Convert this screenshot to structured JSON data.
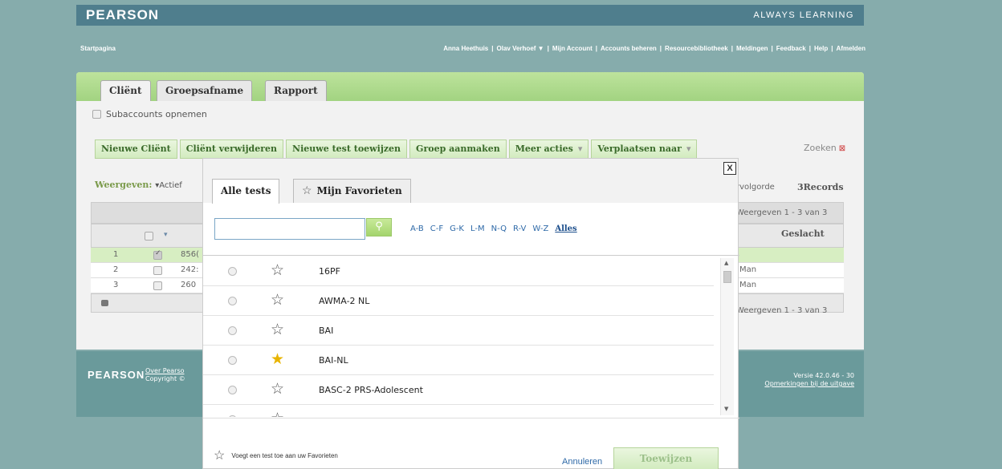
{
  "header": {
    "logo": "PEARSON",
    "slogan": "ALWAYS LEARNING"
  },
  "nav": {
    "home": "Startpagina",
    "user": "Anna Heethuis",
    "links": [
      "Olav Verhoef ▼",
      "Mijn Account",
      "Accounts beheren",
      "Resourcebibliotheek",
      "Meldingen",
      "Feedback",
      "Help",
      "Afmelden"
    ]
  },
  "tabs": [
    "Cliënt",
    "Groepsafname",
    "Rapport"
  ],
  "subaccounts_label": "Subaccounts opnemen",
  "toolbar": {
    "buttons": [
      "Nieuwe Cliënt",
      "Cliënt verwijderen",
      "Nieuwe test toewijzen",
      "Groep aanmaken",
      "Meer acties",
      "Verplaatsen naar"
    ],
    "search": "Zoeken"
  },
  "view": {
    "label": "Weergeven:",
    "value": "▾Actief"
  },
  "grid": {
    "sort_label": "rvolgorde",
    "records": "3Records",
    "paging_top": "Weergeven 1 - 3 van 3",
    "paging_bottom": "Weergeven 1 - 3 van 3",
    "gender_header": "Geslacht",
    "rows": [
      {
        "num": "1",
        "id": "856(",
        "gender": "",
        "checked": true
      },
      {
        "num": "2",
        "id": "242:",
        "gender": "Man",
        "checked": false
      },
      {
        "num": "3",
        "id": "260",
        "gender": "Man",
        "checked": false
      }
    ]
  },
  "footer": {
    "logo": "PEARSON",
    "over": "Over Pearso",
    "copyright": "Copyright ©",
    "version": "Versie 42.0.46 - 30",
    "release_notes": "Opmerkingen bij de uitgave"
  },
  "modal": {
    "close": "X",
    "tabs": {
      "all": "Alle tests",
      "favorites": "Mijn Favorieten"
    },
    "search_value": "",
    "alpha": [
      "A-B",
      "C-F",
      "G-K",
      "L-M",
      "N-Q",
      "R-V",
      "W-Z"
    ],
    "alpha_all": "Alles",
    "tests": [
      {
        "name": "16PF",
        "favorite": false
      },
      {
        "name": "AWMA-2 NL",
        "favorite": false
      },
      {
        "name": "BAI",
        "favorite": false
      },
      {
        "name": "BAI-NL",
        "favorite": true
      },
      {
        "name": "BASC-2 PRS-Adolescent",
        "favorite": false
      },
      {
        "name": "",
        "favorite": false
      }
    ],
    "hint": "Voegt een test toe aan uw Favorieten",
    "cancel": "Annuleren",
    "assign": "Toewijzen"
  }
}
